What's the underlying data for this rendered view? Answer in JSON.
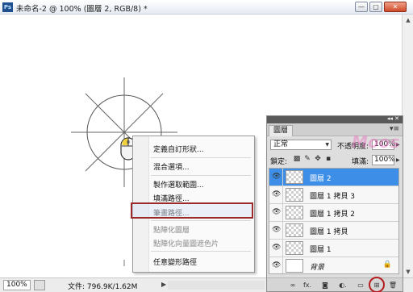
{
  "window": {
    "title": "未命名-2 @ 100% (圖層 2, RGB/8) *",
    "app_icon": "Ps",
    "buttons": {
      "minimize": "—",
      "maximize": "▢",
      "close": "✕"
    }
  },
  "context_menu": {
    "items": [
      {
        "label": "定義自訂形狀...",
        "enabled": true
      },
      {
        "label": "混合選項...",
        "enabled": true
      },
      {
        "label": "製作選取範圍...",
        "enabled": true
      },
      {
        "label": "填滿路徑...",
        "enabled": true
      },
      {
        "label": "筆畫路徑...",
        "enabled": true,
        "highlighted": true
      },
      {
        "label": "點陣化圖層",
        "enabled": false
      },
      {
        "label": "點陣化向量圖遮色片",
        "enabled": false
      },
      {
        "label": "任意變形路徑",
        "enabled": true
      }
    ]
  },
  "statusbar": {
    "zoom": "100%",
    "doc_info": "文件: 796.9K/1.62M"
  },
  "layers_panel": {
    "tab": "圖層",
    "blend_mode": "正常",
    "opacity_label": "不透明度:",
    "opacity": "100%",
    "lock_label": "鎖定:",
    "fill_label": "填滿:",
    "fill": "100%",
    "layers": [
      {
        "name": "圖層 2",
        "selected": true,
        "thumb": "transparent"
      },
      {
        "name": "圖層 1 拷貝 3",
        "selected": false,
        "thumb": "transparent"
      },
      {
        "name": "圖層 1 拷貝 2",
        "selected": false,
        "thumb": "transparent"
      },
      {
        "name": "圖層 1 拷貝",
        "selected": false,
        "thumb": "transparent"
      },
      {
        "name": "圖層 1",
        "selected": false,
        "thumb": "transparent"
      },
      {
        "name": "背景",
        "selected": false,
        "thumb": "white",
        "locked": true
      }
    ],
    "footer_icons": [
      "link-icon",
      "fx-icon",
      "mask-icon",
      "adjustment-icon",
      "group-icon",
      "new-layer-icon",
      "trash-icon"
    ],
    "footer_labels": {
      "link": "∞",
      "fx": "fx.",
      "mask": "◙",
      "adjust": "◐.",
      "group": "▭",
      "new": "⊞",
      "trash": "🗑"
    }
  },
  "watermark": "Moos",
  "colors": {
    "selection": "#3d8ee6",
    "highlight_outline": "#9c2a2a"
  }
}
